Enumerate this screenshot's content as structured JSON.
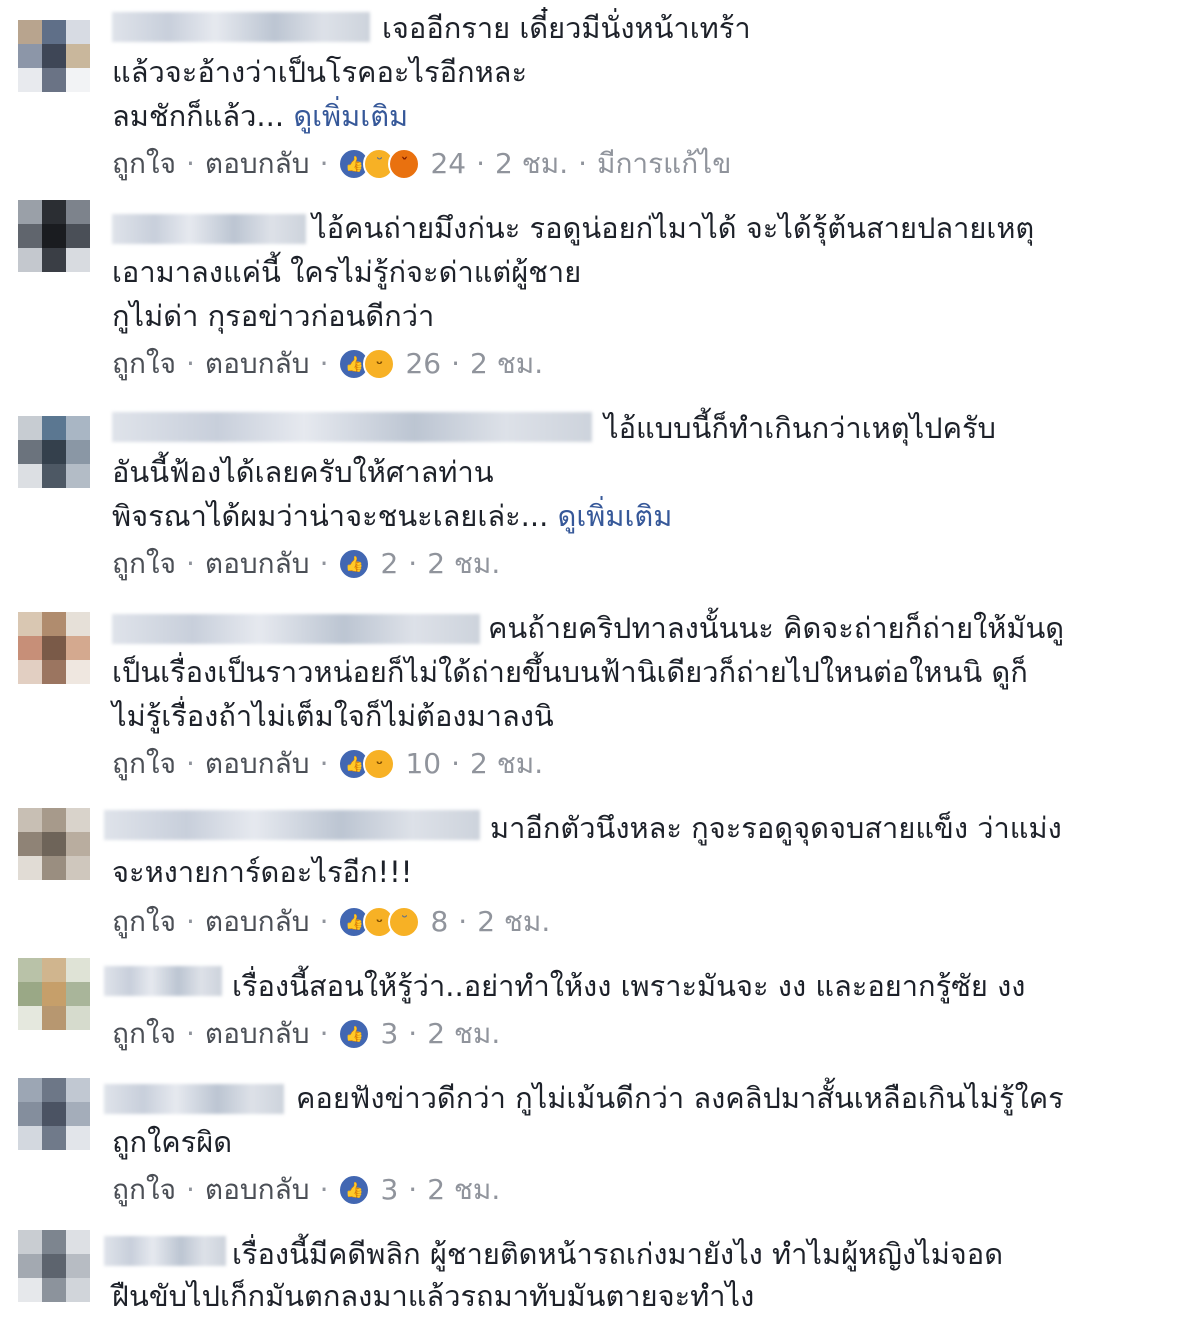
{
  "ui": {
    "like": "ถูกใจ",
    "reply": "ตอบกลับ",
    "dot": "·"
  },
  "comments": [
    {
      "lines": [
        "เจออีกราย เดี๋ยวมีนั่งหน้าเทร้า",
        "แล้วจะอ้างว่าเป็นโรคอะไรอีกหละ",
        "ลมชักก็แล้ว... "
      ],
      "see_more": "ดูเพิ่มเติม",
      "reactions": [
        "like-icon",
        "sad-icon",
        "angry-icon"
      ],
      "count": "24",
      "time": "2 ชม.",
      "edited": "มีการแก้ไข"
    },
    {
      "lines": [
        "ไอ้คนถ่ายมึงก่นะ รอดูน่อยก่ไมาได้ จะได้รุ้ต้นสายปลายเหตุ",
        "เอามาลงแค่นี้ ใครไม่รู้ก่จะด่าแต่ผู้ชาย",
        "กูไม่ด่า กุรอข่าวก่อนดีกว่า"
      ],
      "reactions": [
        "like-icon",
        "haha-icon"
      ],
      "count": "26",
      "time": "2 ชม."
    },
    {
      "lines": [
        "ไอ้แบบนี้ก็ทำเกินกว่าเหตุไปครับ",
        "อันนี้ฟ้องได้เลยครับให้ศาลท่าน",
        "พิจรณาได้ผมว่าน่าจะชนะเลยเล่ะ... "
      ],
      "see_more": "ดูเพิ่มเติม",
      "reactions": [
        "like-icon"
      ],
      "count": "2",
      "time": "2 ชม."
    },
    {
      "lines": [
        "คนถ้ายคริปทาลงนั้นนะ คิดจะถ่ายก็ถ่ายให้มันดู",
        "เป็นเรื่องเป็นราวหน่อยก็ไม่ใด้ถ่ายขึ้นบนฟ้านิเดียวก็ถ่ายไปใหนต่อใหนนิ ดูก็",
        "ไม่รู้เรื่องถ้าไม่เต็มใจก็ไม่ต้องมาลงนิ"
      ],
      "reactions": [
        "like-icon",
        "haha-icon"
      ],
      "count": "10",
      "time": "2 ชม."
    },
    {
      "lines": [
        "มาอีกตัวนึงหละ กูจะรอดูจุดจบสายแข็ง ว่าแม่ง",
        "จะหงายการ์ดอะไรอีก!!!"
      ],
      "reactions": [
        "like-icon",
        "haha-icon",
        "sad-icon"
      ],
      "count": "8",
      "time": "2 ชม."
    },
    {
      "lines": [
        "เรื่องนี้สอนให้รู้ว่า..อย่าทำให้งง เพราะมันจะ งง และอยากรู้ซัย งง"
      ],
      "reactions": [
        "like-icon"
      ],
      "count": "3",
      "time": "2 ชม."
    },
    {
      "lines": [
        "คอยฟังข่าวดีกว่า กูไม่เม้นดีกว่า ลงคลิปมาสั้นเหลือเกินไม่รู้ใคร",
        "ถูกใครผิด"
      ],
      "reactions": [
        "like-icon"
      ],
      "count": "3",
      "time": "2 ชม."
    },
    {
      "lines": [
        "เรื่องนี้มีคดีพลิก ผู้ชายติดหน้ารถเก่งมายังไง ทำไมผู้หญิงไม่จอด",
        "ฝืนขับไปเก็กมันตกลงมาแล้วรถมาทับมันตายจะทำไง"
      ],
      "reactions": [],
      "count": "",
      "time": ""
    }
  ]
}
